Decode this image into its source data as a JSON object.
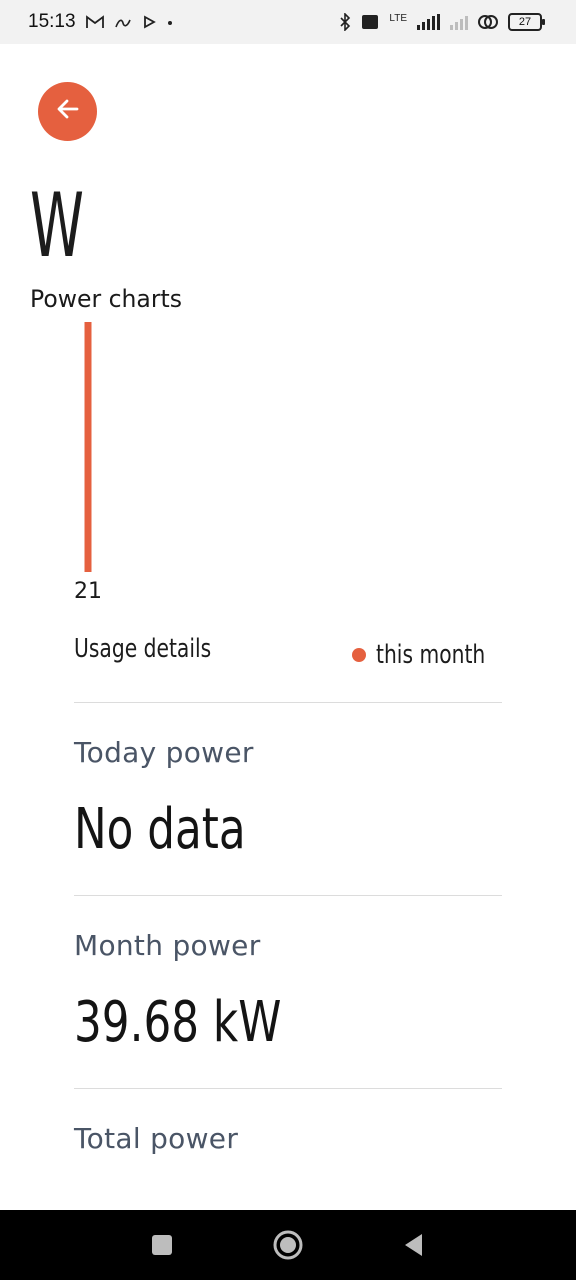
{
  "status_bar": {
    "time": "15:13",
    "battery": "27",
    "network": "LTE"
  },
  "header": {
    "title": "W",
    "subtitle": "Power charts"
  },
  "chart_data": {
    "type": "bar",
    "categories": [
      "21"
    ],
    "series": [
      {
        "name": "this month",
        "values": [
          39.68
        ]
      }
    ],
    "title": "",
    "xlabel": "",
    "ylabel": "",
    "ylim": [
      0,
      39.68
    ],
    "grid": false,
    "legend": "none"
  },
  "usage": {
    "title": "Usage details",
    "legend_label": "this month"
  },
  "stats": {
    "today_label": "Today power",
    "today_value": "No data",
    "month_label": "Month power",
    "month_value": "39.68 kW",
    "total_label": "Total power"
  },
  "colors": {
    "accent": "#e5603f"
  }
}
